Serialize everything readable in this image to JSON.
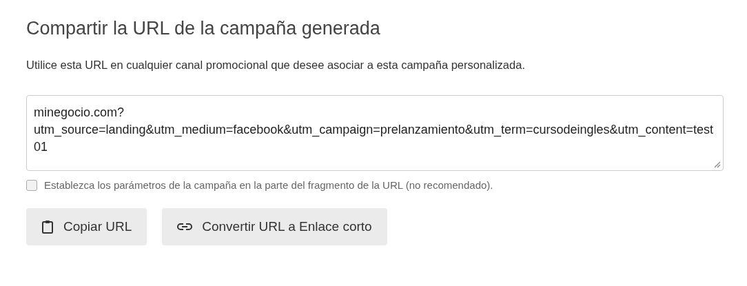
{
  "title": "Compartir la URL de la campaña generada",
  "description": "Utilice esta URL en cualquier canal promocional que desee asociar a esta campaña personalizada.",
  "url_field": {
    "value": "minegocio.com?utm_source=landing&utm_medium=facebook&utm_campaign=prelanzamiento&utm_term=cursodeingles&utm_content=test01"
  },
  "fragment_option": {
    "label": "Establezca los parámetros de la campaña en la parte del fragmento de la URL (no recomendado).",
    "checked": false
  },
  "buttons": [
    {
      "label": "Copiar URL",
      "kind": "copy"
    },
    {
      "label": "Convertir URL a Enlace corto",
      "kind": "link"
    }
  ]
}
